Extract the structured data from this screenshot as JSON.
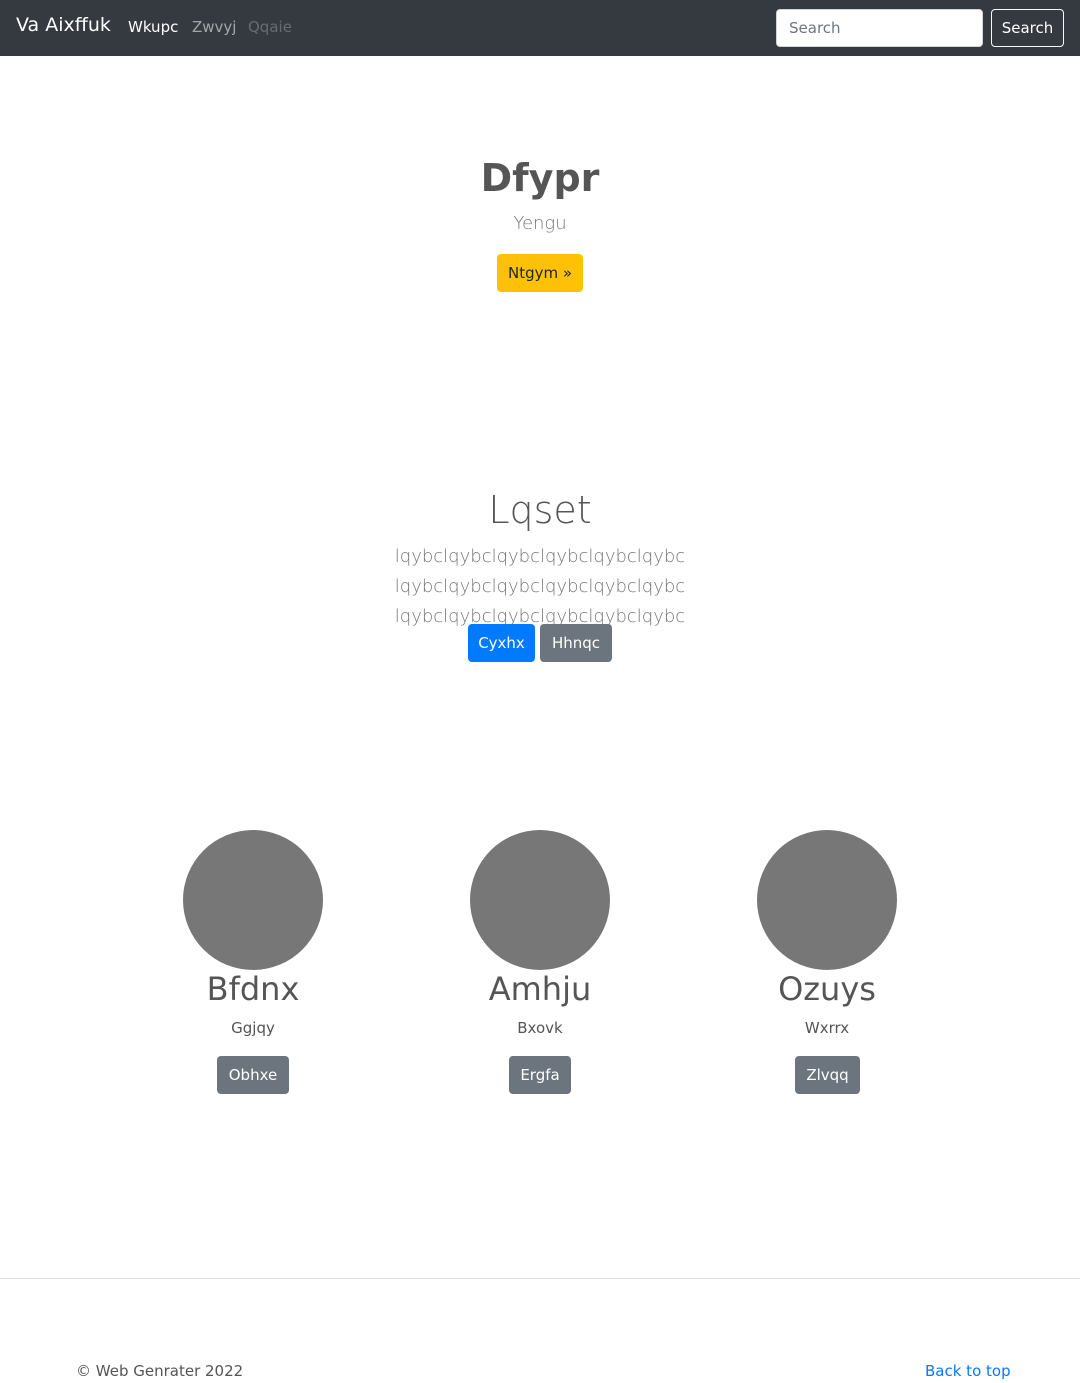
{
  "navbar": {
    "brand": "Va Aixffuk",
    "links": [
      {
        "label": "Wkupc",
        "state": "active"
      },
      {
        "label": "Zwvyj",
        "state": "normal"
      },
      {
        "label": "Qqaie",
        "state": "disabled"
      }
    ],
    "search": {
      "placeholder": "Search",
      "button_label": "Search"
    }
  },
  "hero": {
    "title": "Dfypr",
    "subtitle": "Yengu",
    "button_label": "Ntgym »"
  },
  "section": {
    "title": "Lqset",
    "text": "lqybclqybclqybclqybclqybclqybc lqybclqybclqybclqybclqybclqybc lqybclqybclqybclqybclqybclqybc",
    "primary_button": "Cyxhx",
    "secondary_button": "Hhnqc"
  },
  "cards": [
    {
      "name": "Bfdnx",
      "subtitle": "Ggjqy",
      "button_label": "Obhxe"
    },
    {
      "name": "Amhju",
      "subtitle": "Bxovk",
      "button_label": "Ergfa"
    },
    {
      "name": "Ozuys",
      "subtitle": "Wxrrx",
      "button_label": "Zlvqq"
    }
  ],
  "footer": {
    "copyright": "© Web Genrater 2022",
    "back_to_top": "Back to top"
  },
  "colors": {
    "navbar": "#343a40",
    "warning": "#ffc107",
    "primary": "#007bff",
    "secondary": "#6c757d",
    "placeholder_circle": "#777777"
  }
}
